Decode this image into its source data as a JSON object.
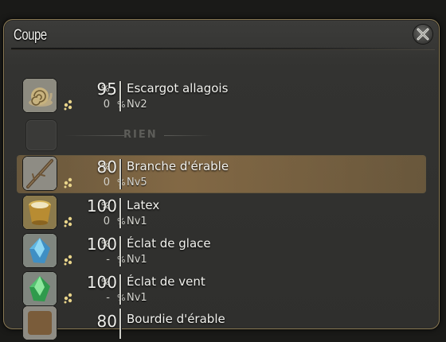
{
  "window": {
    "title": "Coupe"
  },
  "empty_label": "RIEN",
  "colors": {
    "selected_row": "#a58049",
    "panel": "#353533",
    "text": "#f2f2ee"
  },
  "items": [
    {
      "name": "Escargot allagois",
      "level": "Nv2",
      "pct": "95",
      "pct_unit": "%",
      "hq": "0",
      "hq_unit": "%",
      "icon": "snail-icon"
    },
    {
      "name": "Branche d'érable",
      "level": "Nv5",
      "pct": "80",
      "pct_unit": "%",
      "hq": "0",
      "hq_unit": "%",
      "icon": "branch-icon",
      "selected": true
    },
    {
      "name": "Latex",
      "level": "Nv1",
      "pct": "100",
      "pct_unit": "%",
      "hq": "0",
      "hq_unit": "%",
      "icon": "latex-cup-icon"
    },
    {
      "name": "Éclat de glace",
      "level": "Nv1",
      "pct": "100",
      "pct_unit": "%",
      "hq": "-",
      "hq_unit": "%",
      "icon": "ice-shard-icon"
    },
    {
      "name": "Éclat de vent",
      "level": "Nv1",
      "pct": "100",
      "pct_unit": "%",
      "hq": "-",
      "hq_unit": "%",
      "icon": "wind-shard-icon"
    },
    {
      "name": "Bourdie d'érable",
      "pct": "80",
      "icon": "wood-icon"
    }
  ]
}
